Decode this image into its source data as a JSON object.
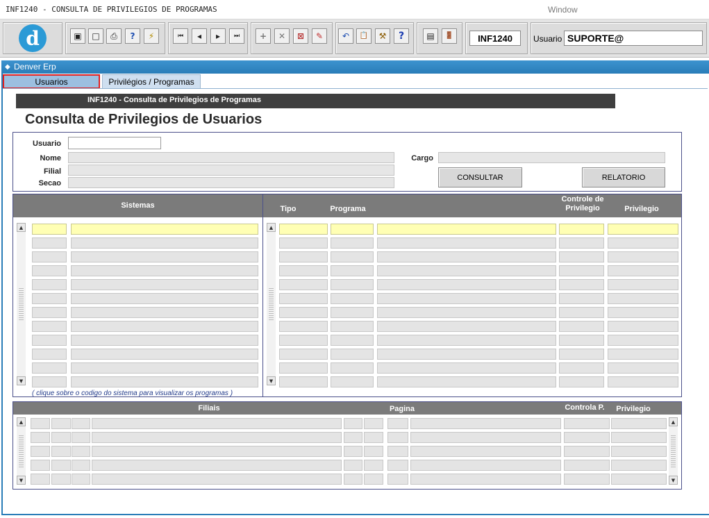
{
  "window": {
    "title": "INF1240 - CONSULTA DE PRIVILEGIOS DE PROGRAMAS",
    "menu": "Window"
  },
  "toolbar": {
    "logo": "d",
    "program_code": "INF1240",
    "user_label": "Usuario",
    "user_value": "SUPORTE@",
    "buttons": [
      {
        "icon": "save-icon",
        "glyph": "▣"
      },
      {
        "icon": "window-icon",
        "glyph": "□"
      },
      {
        "icon": "print-icon",
        "glyph": "⎙"
      },
      {
        "icon": "query-icon",
        "glyph": "?"
      },
      {
        "icon": "execute-icon",
        "glyph": "⚡"
      },
      {
        "icon": "first-record-icon",
        "glyph": "⏮"
      },
      {
        "icon": "prev-record-icon",
        "glyph": "◂"
      },
      {
        "icon": "next-record-icon",
        "glyph": "▸"
      },
      {
        "icon": "last-record-icon",
        "glyph": "⏭"
      },
      {
        "icon": "insert-record-icon",
        "glyph": "+"
      },
      {
        "icon": "delete-record-icon",
        "glyph": "✕"
      },
      {
        "icon": "cancel-query-icon",
        "glyph": "⊠"
      },
      {
        "icon": "edit-icon",
        "glyph": "✎"
      },
      {
        "icon": "undo-icon",
        "glyph": "↶"
      },
      {
        "icon": "clipboard-icon",
        "glyph": "📋"
      },
      {
        "icon": "tools-icon",
        "glyph": "⚒"
      },
      {
        "icon": "help-icon",
        "glyph": "?"
      },
      {
        "icon": "menu-icon",
        "glyph": "▤"
      },
      {
        "icon": "exit-door-icon",
        "glyph": "🚪"
      }
    ]
  },
  "app": {
    "title": "Denver Erp"
  },
  "tabs": [
    {
      "label": "Usuarios"
    },
    {
      "label": "Privilégios / Programas"
    }
  ],
  "header_bar": "INF1240 - Consulta de Privilegios de Programas",
  "page_title": "Consulta de Privilegios de Usuarios",
  "form": {
    "usuario_label": "Usuario",
    "nome_label": "Nome",
    "filial_label": "Filial",
    "secao_label": "Secao",
    "cargo_label": "Cargo",
    "consultar_label": "CONSULTAR",
    "relatorio_label": "RELATORIO"
  },
  "sistemas": {
    "header": "Sistemas",
    "note": "( clique sobre o codigo do sistema para visualizar os programas )",
    "rows": 12
  },
  "programas": {
    "col_tipo": "Tipo",
    "col_programa": "Programa",
    "col_controle": "Controle de Privilegio",
    "col_privilegio": "Privilegio",
    "rows": 12
  },
  "filiais": {
    "col_filiais": "Filiais",
    "col_pagina": "Pagina",
    "col_controla": "Controla P.",
    "col_privilegio": "Privilegio",
    "rows": 5
  }
}
